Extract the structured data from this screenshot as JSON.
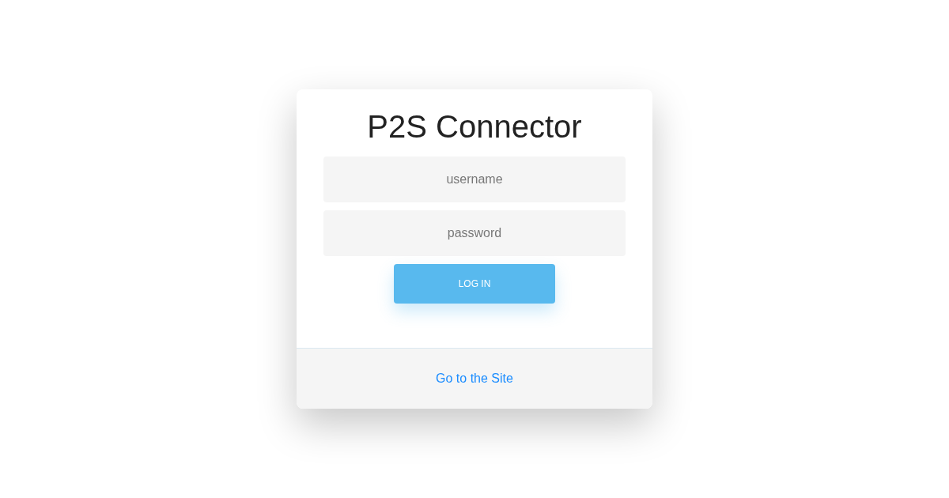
{
  "title": "P2S Connector",
  "fields": [
    {
      "placeholder": "username"
    },
    {
      "placeholder": "password"
    }
  ],
  "button": "LOG IN",
  "footer_link": "Go to the Site"
}
